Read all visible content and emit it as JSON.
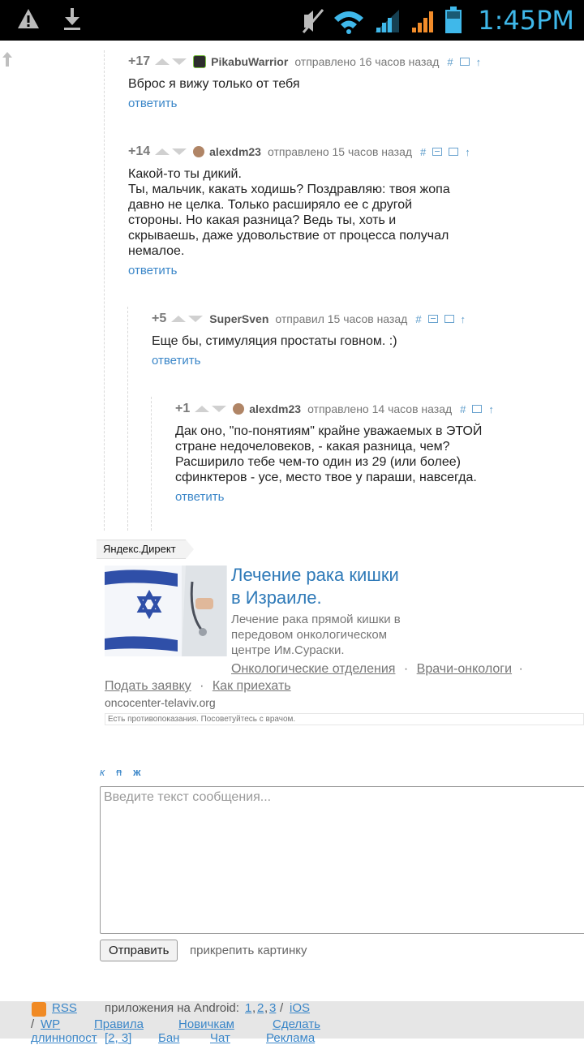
{
  "status_bar": {
    "time": "1:45PM"
  },
  "comments": [
    {
      "rating": "+17",
      "author": "PikabuWarrior",
      "sent": "отправлено 16 часов назад",
      "text": [
        "Вброс я вижу только от тебя"
      ],
      "reply": "ответить"
    },
    {
      "rating": "+14",
      "author": "alexdm23",
      "sent": "отправлено 15 часов назад",
      "text": [
        "Какой-то ты дикий.",
        "Ты, мальчик, какать ходишь? Поздравляю: твоя жопа",
        "давно не целка. Только расширяло ее с другой",
        "стороны. Но какая разница? Ведь ты, хоть и",
        "скрываешь, даже удовольствие от процесса получал",
        "немалое."
      ],
      "reply": "ответить"
    },
    {
      "rating": "+5",
      "author": "SuperSven",
      "sent": "отправил 15 часов назад",
      "text": [
        "Еще бы, стимуляция простаты говном. :)"
      ],
      "reply": "ответить"
    },
    {
      "rating": "+1",
      "author": "alexdm23",
      "sent": "отправлено 14 часов назад",
      "text": [
        "Дак оно, \"по-понятиям\" крайне уважаемых в ЭТОЙ",
        "стране недочеловеков, - какая разница, чем?",
        "Расширило тебе чем-то один из 29 (или более)",
        "сфинктеров - усе, место твое у параши, навсегда."
      ],
      "reply": "ответить"
    }
  ],
  "ad": {
    "label": "Яндекс.Директ",
    "title_line1": "Лечение рака кишки",
    "title_line2": "в Израиле.",
    "desc_lines": [
      "Лечение рака прямой кишки в",
      "передовом онкологическом",
      "центре Им.Сураски."
    ],
    "link1": "Онкологические отделения",
    "link2": "Врачи-онкологи",
    "link3": "Подать заявку",
    "link4": "Как приехать",
    "sep": "·",
    "domain": "oncocenter-telaviv.org",
    "warning": "Есть противопоказания. Посоветуйтесь с врачом."
  },
  "editor": {
    "fmt_italic": "к",
    "fmt_strike": "п",
    "fmt_bold": "ж",
    "placeholder": "Введите текст сообщения...",
    "send": "Отправить",
    "attach": "прикрепить картинку"
  },
  "footer": {
    "rss": "RSS",
    "android_label": "приложения на Android:",
    "android_1": "1",
    "android_2": "2",
    "android_3": "3",
    "ios": "iOS",
    "wp": "WP",
    "rules": "Правила",
    "newbies": "Новичкам",
    "make": "Сделать",
    "longpost": "длиннопост",
    "longpost_nums": "[2, 3]",
    "ban": "Бан",
    "chat": "Чат",
    "ads": "Реклама",
    "slash": "/",
    "comma": ","
  },
  "colors": {
    "link": "#3a86c8",
    "status_time": "#3fb8ea",
    "ad_title": "#2f7ab8"
  }
}
